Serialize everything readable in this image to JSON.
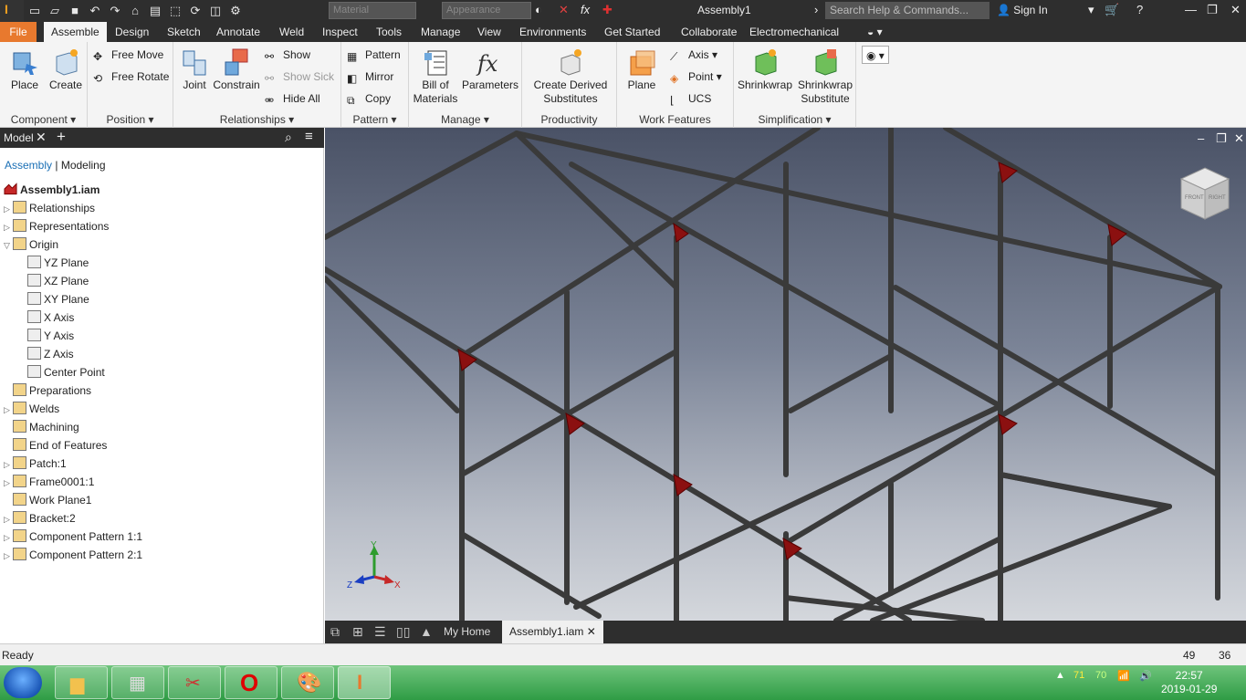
{
  "qat": {
    "material_placeholder": "Material",
    "appearance_placeholder": "Appearance",
    "window_title": "Assembly1",
    "search_placeholder": "Search Help & Commands...",
    "sign_in": "Sign In"
  },
  "tabs": [
    "File",
    "Assemble",
    "Design",
    "Sketch",
    "Annotate",
    "Weld",
    "Inspect",
    "Tools",
    "Manage",
    "View",
    "Environments",
    "Get Started",
    "Collaborate",
    "Electromechanical"
  ],
  "ribbon": {
    "component": {
      "label": "Component",
      "place": "Place",
      "create": "Create"
    },
    "position": {
      "label": "Position",
      "free_move": "Free Move",
      "free_rotate": "Free Rotate"
    },
    "relationships": {
      "label": "Relationships",
      "joint": "Joint",
      "constrain": "Constrain",
      "show": "Show",
      "show_sick": "Show Sick",
      "hide_all": "Hide All"
    },
    "pattern": {
      "label": "Pattern",
      "pattern": "Pattern",
      "mirror": "Mirror",
      "copy": "Copy"
    },
    "manage": {
      "label": "Manage",
      "bom_line1": "Bill of",
      "bom_line2": "Materials",
      "parameters": "Parameters"
    },
    "productivity": {
      "label": "Productivity",
      "derived_line1": "Create Derived",
      "derived_line2": "Substitutes"
    },
    "work_features": {
      "label": "Work Features",
      "plane": "Plane",
      "axis": "Axis",
      "point": "Point",
      "ucs": "UCS"
    },
    "simplification": {
      "label": "Simplification",
      "shrinkwrap": "Shrinkwrap",
      "sws_line1": "Shrinkwrap",
      "sws_line2": "Substitute"
    }
  },
  "browser": {
    "title": "Model",
    "sub_assembly": "Assembly",
    "sub_sep": "|",
    "sub_modeling": "Modeling",
    "root": "Assembly1.iam",
    "items": [
      {
        "label": "Relationships",
        "level": 1,
        "expand": "right"
      },
      {
        "label": "Representations",
        "level": 1,
        "expand": "right"
      },
      {
        "label": "Origin",
        "level": 1,
        "expand": "down"
      },
      {
        "label": "YZ Plane",
        "level": 2,
        "expand": ""
      },
      {
        "label": "XZ Plane",
        "level": 2,
        "expand": ""
      },
      {
        "label": "XY Plane",
        "level": 2,
        "expand": ""
      },
      {
        "label": "X Axis",
        "level": 2,
        "expand": ""
      },
      {
        "label": "Y Axis",
        "level": 2,
        "expand": ""
      },
      {
        "label": "Z Axis",
        "level": 2,
        "expand": ""
      },
      {
        "label": "Center Point",
        "level": 2,
        "expand": ""
      },
      {
        "label": "Preparations",
        "level": 1,
        "expand": ""
      },
      {
        "label": "Welds",
        "level": 1,
        "expand": "right"
      },
      {
        "label": "Machining",
        "level": 1,
        "expand": ""
      },
      {
        "label": "End of Features",
        "level": 1,
        "expand": ""
      },
      {
        "label": "Patch:1",
        "level": 1,
        "expand": "right"
      },
      {
        "label": "Frame0001:1",
        "level": 1,
        "expand": "right"
      },
      {
        "label": "Work Plane1",
        "level": 1,
        "expand": ""
      },
      {
        "label": "Bracket:2",
        "level": 1,
        "expand": "right"
      },
      {
        "label": "Component Pattern 1:1",
        "level": 1,
        "expand": "right"
      },
      {
        "label": "Component Pattern 2:1",
        "level": 1,
        "expand": "right"
      }
    ]
  },
  "viewcube": {
    "front": "FRONT",
    "right": "RIGHT"
  },
  "triad": {
    "x": "X",
    "y": "Y",
    "z": "Z"
  },
  "doc_tabs": {
    "home": "My Home",
    "active": "Assembly1.iam"
  },
  "status": {
    "text": "Ready",
    "count1": "49",
    "count2": "36"
  },
  "tray": {
    "n1": "71",
    "n2": "70",
    "time": "22:57",
    "date": "2019-01-29"
  },
  "colors": {
    "accent": "#e8792e",
    "dark_chrome": "#2e2e2e",
    "bracket_red": "#8b1010",
    "tube": "#4a4a4a"
  }
}
